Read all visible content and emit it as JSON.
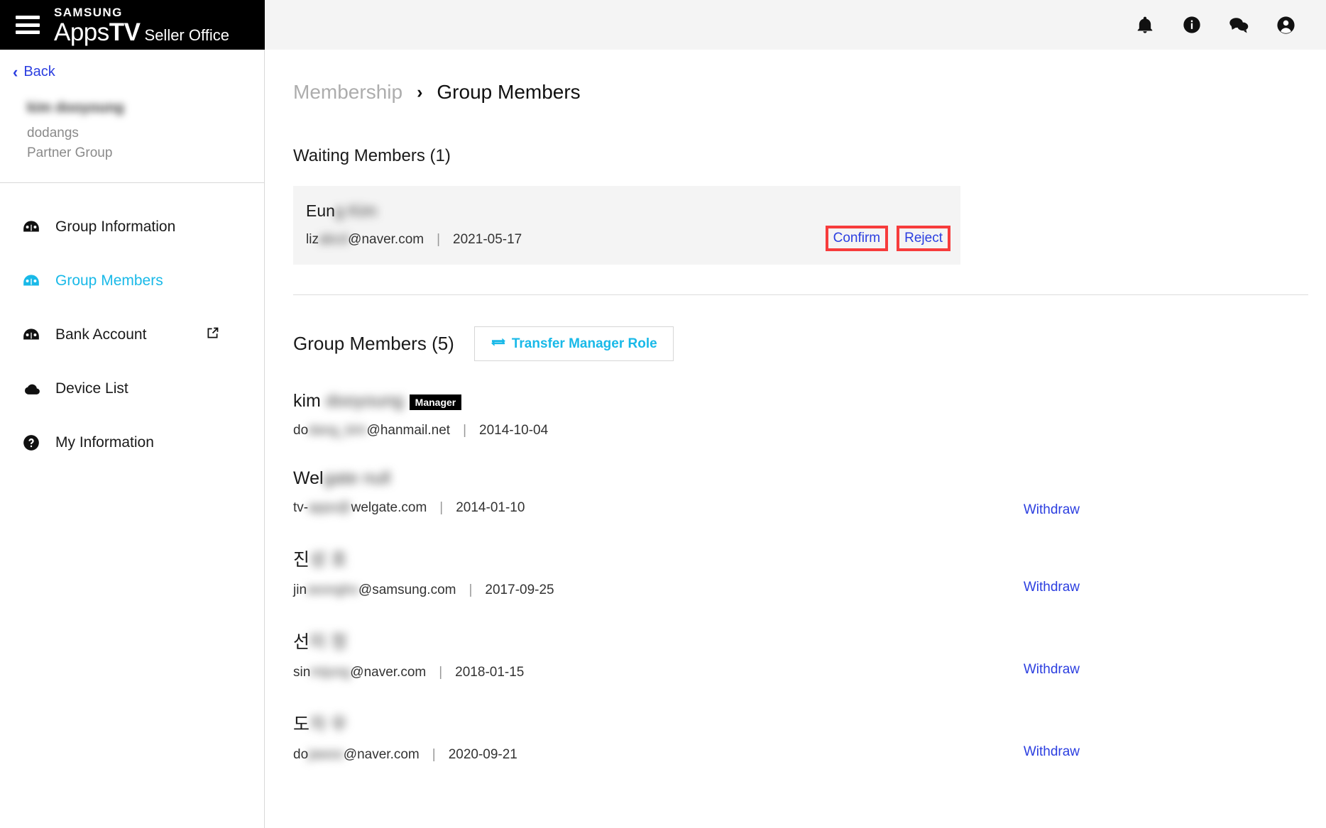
{
  "header": {
    "brand_samsung": "SAMSUNG",
    "brand_apps": "Apps",
    "brand_tv": "TV",
    "brand_seller": "Seller Office",
    "icons": [
      "bell-icon",
      "info-circle-icon",
      "chat-icon",
      "account-circle-icon"
    ]
  },
  "sidebar": {
    "back_label": "Back",
    "profile": {
      "name": "kim dooyoung",
      "account": "dodangs",
      "group_type": "Partner Group"
    },
    "items": [
      {
        "label": "Group Information",
        "icon": "dashboard-icon",
        "active": false,
        "external": false
      },
      {
        "label": "Group Members",
        "icon": "dashboard-icon",
        "active": true,
        "external": false
      },
      {
        "label": "Bank Account",
        "icon": "dashboard-icon",
        "active": false,
        "external": true
      },
      {
        "label": "Device List",
        "icon": "cloud-icon",
        "active": false,
        "external": false
      },
      {
        "label": "My Information",
        "icon": "question-circle-icon",
        "active": false,
        "external": false
      }
    ]
  },
  "breadcrumb": {
    "parent": "Membership",
    "separator": "›",
    "current": "Group Members"
  },
  "waiting": {
    "title": "Waiting Members (1)",
    "member": {
      "name_visible": "Eun",
      "name_blurred": "g Kim",
      "email_visible": "liz",
      "email_blurred": "abcd",
      "email_domain": "@naver.com",
      "separator": "|",
      "date": "2021-05-17"
    },
    "confirm_label": "Confirm",
    "reject_label": "Reject"
  },
  "group": {
    "title": "Group Members (5)",
    "transfer_label": "Transfer Manager Role",
    "transfer_icon": "swap-horizontal-icon",
    "withdraw_label": "Withdraw",
    "manager_badge": "Manager",
    "separator": "|",
    "members": [
      {
        "name_visible": "kim",
        "name_blurred": "dooyoung",
        "badge": "Manager",
        "email_visible": "do",
        "email_blurred": "dang_kim",
        "email_domain": "@hanmail.net",
        "date": "2014-10-04",
        "withdraw": false
      },
      {
        "name_visible": "Wel",
        "name_blurred": "gate null",
        "badge": "",
        "email_visible": "tv-",
        "email_blurred": "apps@",
        "email_domain": "welgate.com",
        "date": "2014-01-10",
        "withdraw": true
      },
      {
        "name_visible": "진",
        "name_blurred": "성 호",
        "badge": "",
        "email_visible": "jin",
        "email_blurred": "seongho",
        "email_domain": "@samsung.com",
        "date": "2017-09-25",
        "withdraw": true
      },
      {
        "name_visible": "선",
        "name_blurred": "미 정",
        "badge": "",
        "email_visible": "sin",
        "email_blurred": "mijung",
        "email_domain": "@naver.com",
        "date": "2018-01-15",
        "withdraw": true
      },
      {
        "name_visible": "도",
        "name_blurred": "자 우",
        "badge": "",
        "email_visible": "do",
        "email_blurred": "jawoo",
        "email_domain": "@naver.com",
        "date": "2020-09-21",
        "withdraw": true
      }
    ]
  },
  "colors": {
    "accent": "#19b9e8",
    "link": "#2b3ee0",
    "annotation": "#f73c3c",
    "brand_black": "#000000",
    "topbar_bg": "#f4f4f4"
  }
}
